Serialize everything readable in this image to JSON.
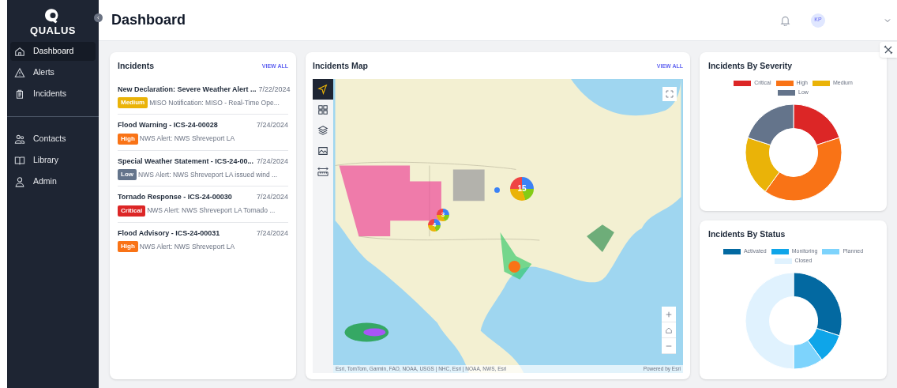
{
  "sidebar": {
    "logo": "QUALUS",
    "nav_groups": [
      [
        {
          "kind": "home",
          "label": "Dashboard",
          "selected": true
        },
        {
          "kind": "alert",
          "label": "Alerts",
          "selected": false
        },
        {
          "kind": "clipboard",
          "label": "Incidents",
          "selected": false
        }
      ],
      [
        {
          "kind": "people",
          "label": "Contacts",
          "selected": false
        },
        {
          "kind": "book",
          "label": "Library",
          "selected": false
        },
        {
          "kind": "person",
          "label": "Admin",
          "selected": false
        }
      ]
    ]
  },
  "header": {
    "title": "Dashboard",
    "avatar": "KP"
  },
  "incidents": {
    "title": "Incidents",
    "link": "VIEW ALL",
    "items": [
      {
        "title": "New Declaration: Severe Weather Alert ...",
        "date": "7/22/2024",
        "badge": "Medium",
        "color": "#eab308",
        "description": "MISO Notification: MISO - Real-Time Ope..."
      },
      {
        "title": "Flood Warning - ICS-24-00028",
        "date": "7/24/2024",
        "badge": "High",
        "color": "#f97316",
        "description": "NWS Alert: NWS Shreveport LA"
      },
      {
        "title": "Special Weather Statement - ICS-24-00...",
        "date": "7/24/2024",
        "badge": "Low",
        "color": "#64748b",
        "description": "NWS Alert: NWS Shreveport LA issued wind ..."
      },
      {
        "title": "Tornado Response - ICS-24-00030",
        "date": "7/24/2024",
        "badge": "Critical",
        "color": "#dc2626",
        "description": "NWS Alert: NWS Shreveport LA Tornado ..."
      },
      {
        "title": "Flood Advisory - ICS-24-00031",
        "date": "7/24/2024",
        "badge": "High",
        "color": "#f97316",
        "description": "NWS Alert: NWS Shreveport LA"
      }
    ]
  },
  "map": {
    "title": "Incidents Map",
    "link": "VIEW ALL",
    "tools": [
      {
        "kind": "navigate",
        "selected": true
      },
      {
        "kind": "grid",
        "selected": false
      },
      {
        "kind": "layers",
        "selected": false
      },
      {
        "kind": "image",
        "selected": false
      },
      {
        "kind": "measure",
        "selected": false
      }
    ],
    "markers": [
      {
        "kind": "cluster",
        "label": "15"
      },
      {
        "kind": "cluster",
        "label": "3"
      },
      {
        "kind": "cluster",
        "label": "4"
      },
      {
        "kind": "point"
      },
      {
        "kind": "point"
      }
    ],
    "attribution": "Esri, TomTom, Garmin, FAO, NOAA, USGS | NHC, Esri | NOAA, NWS, Esri",
    "powered_by": "Powered by Esri"
  },
  "severity": {
    "title": "Incidents By Severity",
    "chart_data": {
      "type": "donut",
      "categories": [
        "Critical",
        "High",
        "Medium",
        "Low"
      ],
      "values": [
        20,
        40,
        20,
        20
      ],
      "colors": [
        "#dc2626",
        "#f97316",
        "#eab308",
        "#64748b"
      ]
    }
  },
  "status": {
    "title": "Incidents By Status",
    "chart_data": {
      "type": "donut",
      "categories": [
        "Activated",
        "Monitoring",
        "Planned",
        "Closed"
      ],
      "values": [
        30,
        10,
        10,
        50
      ],
      "colors": [
        "#0369a1",
        "#0ea5e9",
        "#7dd3fc",
        "#e0f2fe"
      ]
    }
  }
}
